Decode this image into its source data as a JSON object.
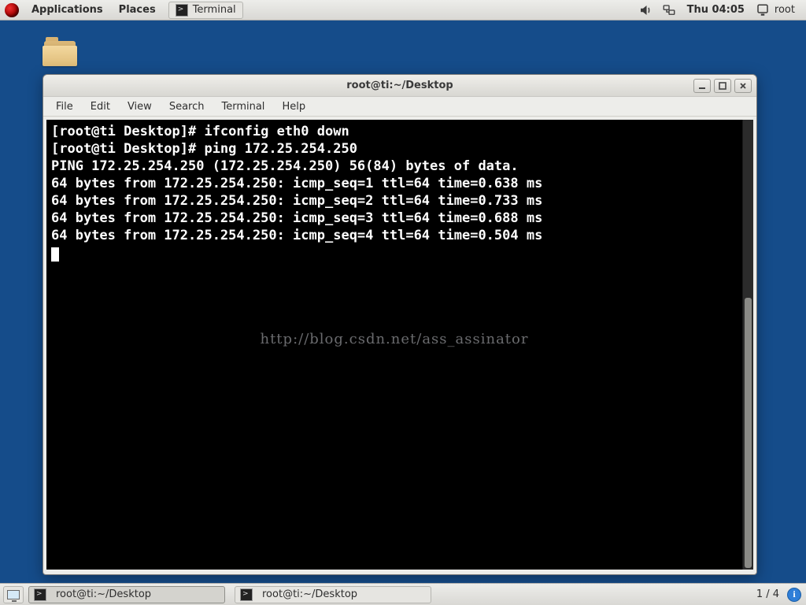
{
  "panel": {
    "applications": "Applications",
    "places": "Places",
    "top_task": "Terminal",
    "clock": "Thu 04:05",
    "user": "root"
  },
  "window": {
    "title": "root@ti:~/Desktop",
    "menu": {
      "file": "File",
      "edit": "Edit",
      "view": "View",
      "search": "Search",
      "terminal": "Terminal",
      "help": "Help"
    }
  },
  "terminal": {
    "lines": [
      "[root@ti Desktop]# ifconfig eth0 down",
      "[root@ti Desktop]# ping 172.25.254.250",
      "PING 172.25.254.250 (172.25.254.250) 56(84) bytes of data.",
      "64 bytes from 172.25.254.250: icmp_seq=1 ttl=64 time=0.638 ms",
      "64 bytes from 172.25.254.250: icmp_seq=2 ttl=64 time=0.733 ms",
      "64 bytes from 172.25.254.250: icmp_seq=3 ttl=64 time=0.688 ms",
      "64 bytes from 172.25.254.250: icmp_seq=4 ttl=64 time=0.504 ms"
    ],
    "watermark": "http://blog.csdn.net/ass_assinator"
  },
  "bottom": {
    "task1": "root@ti:~/Desktop",
    "task2": "root@ti:~/Desktop",
    "workspace": "1 / 4"
  }
}
